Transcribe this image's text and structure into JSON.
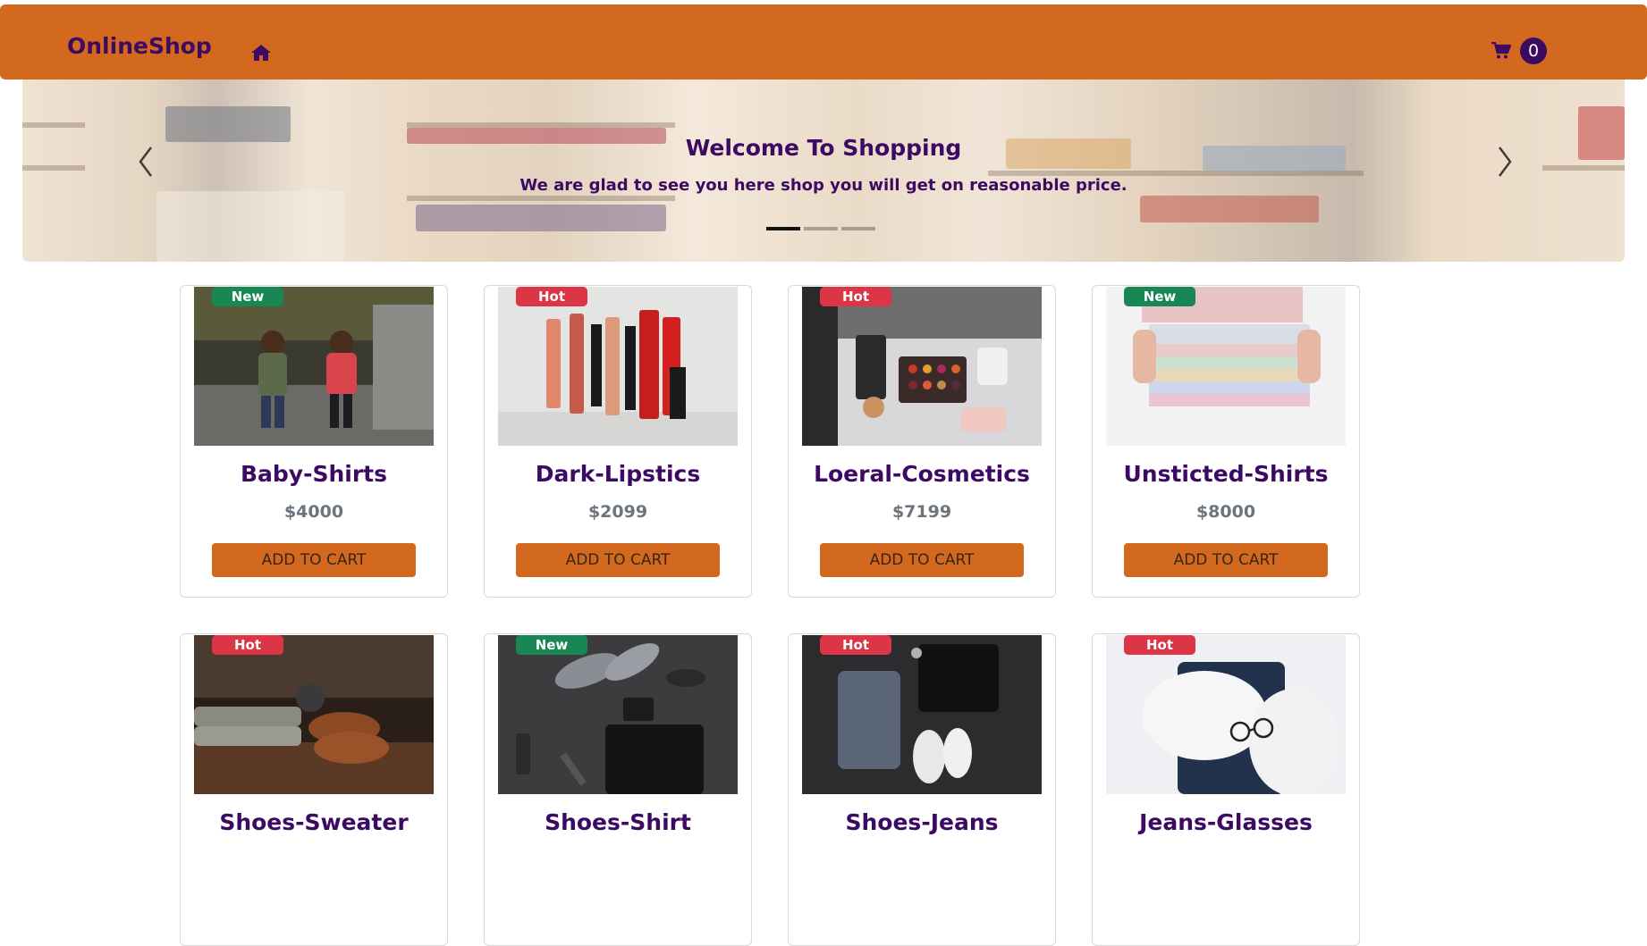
{
  "navbar": {
    "brand": "OnlineShop",
    "home_icon": "home-icon",
    "cart_icon": "shopping-cart-icon",
    "cart_count": "0"
  },
  "carousel": {
    "title": "Welcome To Shopping",
    "subtitle": "We are glad to see you here shop you will get on reasonable price.",
    "slides": 3,
    "active_slide": 1
  },
  "colors": {
    "primary": "#d2691e",
    "accent": "#3d0a63",
    "badge_new": "#198754",
    "badge_hot": "#dc3545"
  },
  "products": [
    {
      "name": "Baby-Shirts",
      "price": "$4000",
      "badge": "New",
      "button": "ADD TO CART"
    },
    {
      "name": "Dark-Lipstics",
      "price": "$2099",
      "badge": "Hot",
      "button": "ADD TO CART"
    },
    {
      "name": "Loeral-Cosmetics",
      "price": "$7199",
      "badge": "Hot",
      "button": "ADD TO CART"
    },
    {
      "name": "Unsticted-Shirts",
      "price": "$8000",
      "badge": "New",
      "button": "ADD TO CART"
    },
    {
      "name": "Shoes-Sweater",
      "badge": "Hot"
    },
    {
      "name": "Shoes-Shirt",
      "badge": "New"
    },
    {
      "name": "Shoes-Jeans",
      "badge": "Hot"
    },
    {
      "name": "Jeans-Glasses",
      "badge": "Hot"
    }
  ]
}
